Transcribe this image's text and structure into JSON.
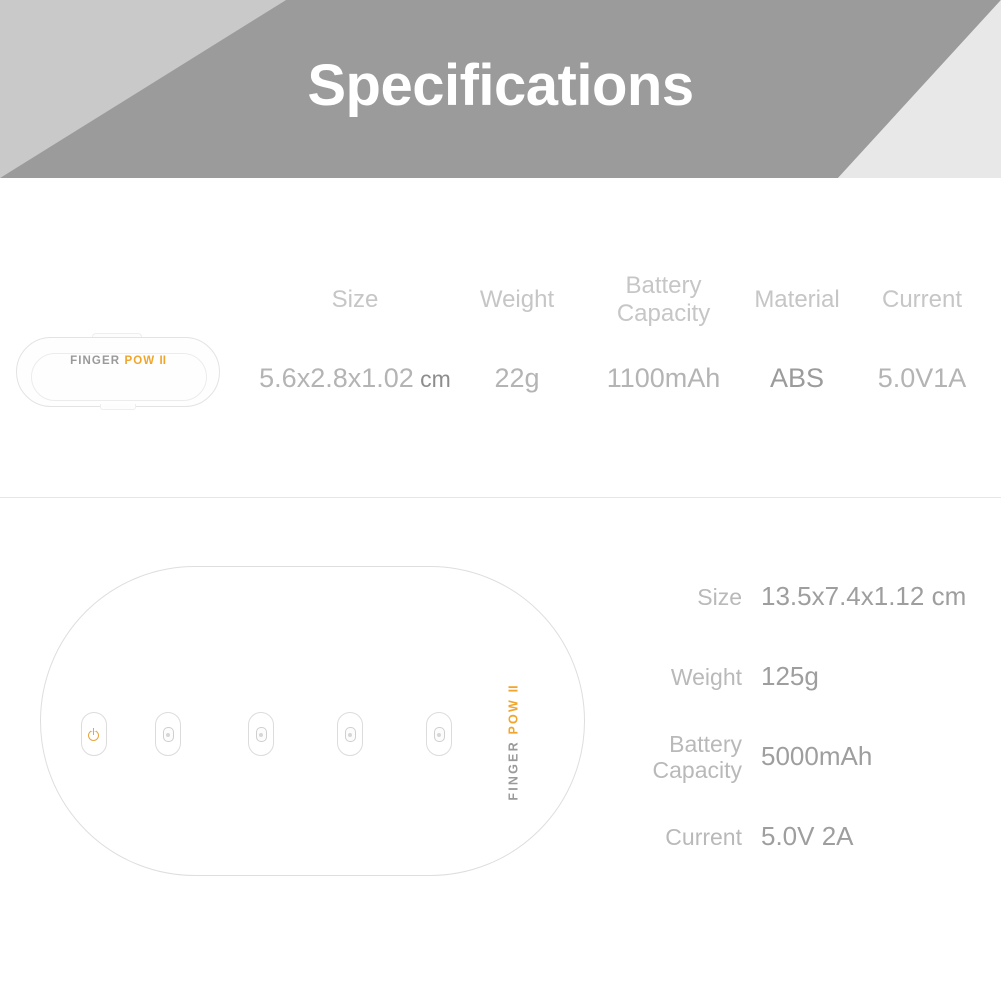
{
  "header": {
    "title": "Specifications",
    "colors": {
      "banner_dark": "#9b9b9b",
      "banner_light_left": "#c9c9c9",
      "banner_light_right": "#e8e8e8",
      "title_color": "#ffffff"
    }
  },
  "brand": {
    "name_primary": "FINGER",
    "name_accent": "POW",
    "name_suffix": "II",
    "accent_color": "#f0a62c",
    "primary_color": "#9a9a9a"
  },
  "section_power_bank": {
    "product_logo": {
      "primary": "FINGER",
      "accent": "POW",
      "suffix": "II"
    },
    "columns": [
      {
        "label": "Size",
        "value": "5.6x2.8x1.02",
        "unit": "cm"
      },
      {
        "label": "Weight",
        "value": "22g",
        "unit": ""
      },
      {
        "label": "Battery Capacity",
        "value": "1100mAh",
        "unit": ""
      },
      {
        "label": "Material",
        "value": "ABS",
        "unit": ""
      },
      {
        "label": "Current",
        "value": "5.0V1A",
        "unit": ""
      }
    ]
  },
  "section_charging_case": {
    "case_logo": {
      "primary": "FINGER",
      "accent": "POW",
      "suffix": "II"
    },
    "slots": [
      {
        "name": "power-slot",
        "icon": "power-icon",
        "accent": true
      },
      {
        "name": "pod-slot-1",
        "icon": "pod-icon",
        "accent": false
      },
      {
        "name": "pod-slot-2",
        "icon": "pod-icon",
        "accent": false
      },
      {
        "name": "pod-slot-3",
        "icon": "pod-icon",
        "accent": false
      },
      {
        "name": "pod-slot-4",
        "icon": "pod-icon",
        "accent": false
      }
    ],
    "specs": [
      {
        "label": "Size",
        "value": "13.5x7.4x1.12 cm"
      },
      {
        "label": "Weight",
        "value": "125g"
      },
      {
        "label": "Battery Capacity",
        "value": "5000mAh"
      },
      {
        "label": "Current",
        "value": "5.0V 2A"
      }
    ]
  }
}
